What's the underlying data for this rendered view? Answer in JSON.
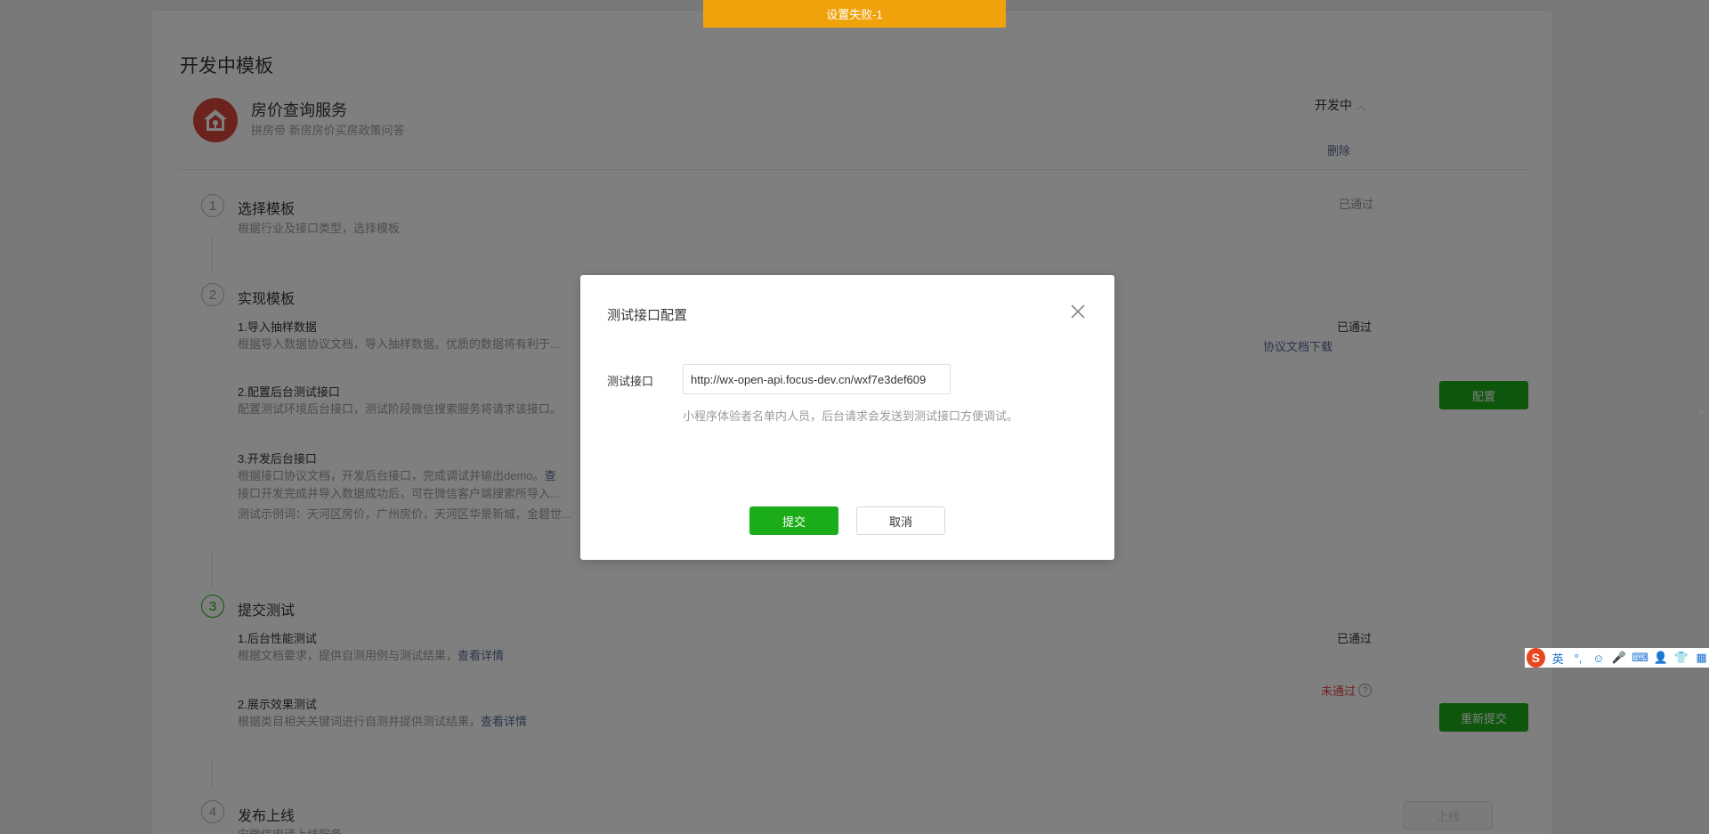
{
  "toast": {
    "text": "设置失败-1"
  },
  "section": {
    "title": "开发中模板"
  },
  "template": {
    "name": "房价查询服务",
    "desc": "拼房帝 新房房价买房政策问答",
    "status": "开发中",
    "delete": "删除"
  },
  "steps": [
    {
      "num": "1",
      "title": "选择模板",
      "desc": "根据行业及接口类型，选择模板",
      "status": "已通过"
    },
    {
      "num": "2",
      "title": "实现模板",
      "sub1_title": "1.导入抽样数据",
      "sub1_desc": "根据导入数据协议文档，导入抽样数据。优质的数据将有利于...",
      "sub1_status": "已通过",
      "sub1_link": "协议文档下载",
      "sub2_title": "2.配置后台测试接口",
      "sub2_desc": "配置测试环境后台接口，测试阶段微信搜索服务将请求该接口。",
      "sub2_btn": "配置",
      "sub3_title": "3.开发后台接口",
      "sub3_desc1": "根据接口协议文档，开发后台接口，完成调试并输出demo。",
      "sub3_link": "查",
      "sub3_desc2": "接口开发完成并导入数据成功后，可在微信客户端搜索所导入...",
      "sub3_desc3": "测试示例词：天河区房价，广州房价，天河区华景新城，金碧世..."
    },
    {
      "num": "3",
      "title": "提交测试",
      "sub1_title": "1.后台性能测试",
      "sub1_desc": "根据文档要求，提供自测用例与测试结果，",
      "sub1_link": "查看详情",
      "sub1_status": "已通过",
      "sub2_title": "2.展示效果测试",
      "sub2_desc": "根据类目相关关键词进行自测并提供测试结果，",
      "sub2_link": "查看详情",
      "sub2_status": "未通过",
      "sub2_help": "?",
      "sub2_btn": "重新提交"
    },
    {
      "num": "4",
      "title": "发布上线",
      "desc": "向微信申请上线服务",
      "btn": "上线"
    }
  ],
  "dialog": {
    "title": "测试接口配置",
    "label": "测试接口",
    "input_value": "http://wx-open-api.focus-dev.cn/wxf7e3def609",
    "hint": "小程序体验者名单内人员，后台请求会发送到测试接口方便调试。",
    "submit": "提交",
    "cancel": "取消"
  },
  "ime": {
    "logo": "S",
    "lang": "英",
    "punct": "°,",
    "emoji": "☺",
    "voice": "🎤",
    "keyboard": "⌨",
    "user": "👤",
    "skin": "👕",
    "apps": "▦"
  },
  "colors": {
    "primary": "#1aad19",
    "toast": "#f0a20a",
    "link": "#576b95",
    "fail": "#e64340"
  }
}
